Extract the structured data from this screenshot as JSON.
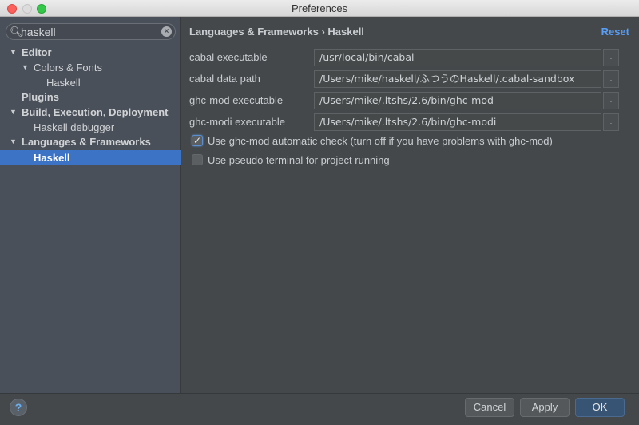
{
  "window": {
    "title": "Preferences"
  },
  "search": {
    "value": "haskell",
    "placeholder": ""
  },
  "tree": [
    {
      "label": "Editor",
      "expanded": true,
      "bold": true
    },
    {
      "label": "Colors & Fonts",
      "expanded": true
    },
    {
      "label": "Haskell"
    },
    {
      "label": "Plugins",
      "bold": true
    },
    {
      "label": "Build, Execution, Deployment",
      "expanded": true,
      "bold": true
    },
    {
      "label": "Haskell debugger"
    },
    {
      "label": "Languages & Frameworks",
      "expanded": true,
      "bold": true
    },
    {
      "label": "Haskell",
      "selected": true
    }
  ],
  "main": {
    "breadcrumb": "Languages & Frameworks › Haskell",
    "reset_label": "Reset",
    "fields": [
      {
        "label": "cabal executable",
        "value": "/usr/local/bin/cabal"
      },
      {
        "label": "cabal data path",
        "value": "/Users/mike/haskell/ふつうのHaskell/.cabal-sandbox"
      },
      {
        "label": "ghc-mod executable",
        "value": "/Users/mike/.ltshs/2.6/bin/ghc-mod"
      },
      {
        "label": "ghc-modi executable",
        "value": "/Users/mike/.ltshs/2.6/bin/ghc-modi"
      }
    ],
    "browse_label": "...",
    "checkboxes": [
      {
        "label": "Use ghc-mod automatic check (turn off if you have problems with ghc-mod)",
        "checked": true
      },
      {
        "label": "Use pseudo terminal for project running",
        "checked": false
      }
    ]
  },
  "footer": {
    "help_label": "?",
    "cancel_label": "Cancel",
    "apply_label": "Apply",
    "ok_label": "OK"
  },
  "colors": {
    "accent": "#589df6",
    "selection": "#3d73c4",
    "ok_button": "#385475"
  }
}
